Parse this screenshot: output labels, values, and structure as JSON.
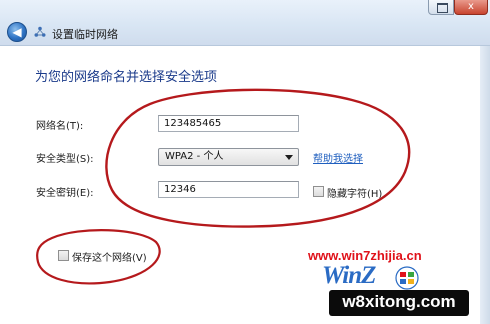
{
  "window": {
    "back_glyph": "◀",
    "title": "设置临时网络",
    "close_glyph": "x"
  },
  "content": {
    "heading": "为您的网络命名并选择安全选项",
    "network_name": {
      "label": "网络名(T):",
      "value": "123485465"
    },
    "security_type": {
      "label": "安全类型(S):",
      "selected": "WPA2 - 个人"
    },
    "help_link": "帮助我选择",
    "security_key": {
      "label": "安全密钥(E):",
      "value": "12346"
    },
    "hide_characters": {
      "label": "隐藏字符(H)",
      "checked": false
    },
    "save_network": {
      "label": "保存这个网络(V)",
      "checked": false
    }
  },
  "watermark": {
    "url": "www.win7zhijia.cn",
    "logo": "WinZ",
    "domain": "w8xitong.com"
  },
  "icons": [
    "back-arrow-icon",
    "network-icon",
    "close-icon",
    "maximize-icon",
    "dropdown-arrow-icon",
    "windows-flag-icon"
  ],
  "colors": {
    "heading": "#1a3a8a",
    "link": "#1f5fbf",
    "annotation": "#b5191c",
    "watermark_red": "#e0121a",
    "watermark_blue": "#2a6bc4"
  }
}
